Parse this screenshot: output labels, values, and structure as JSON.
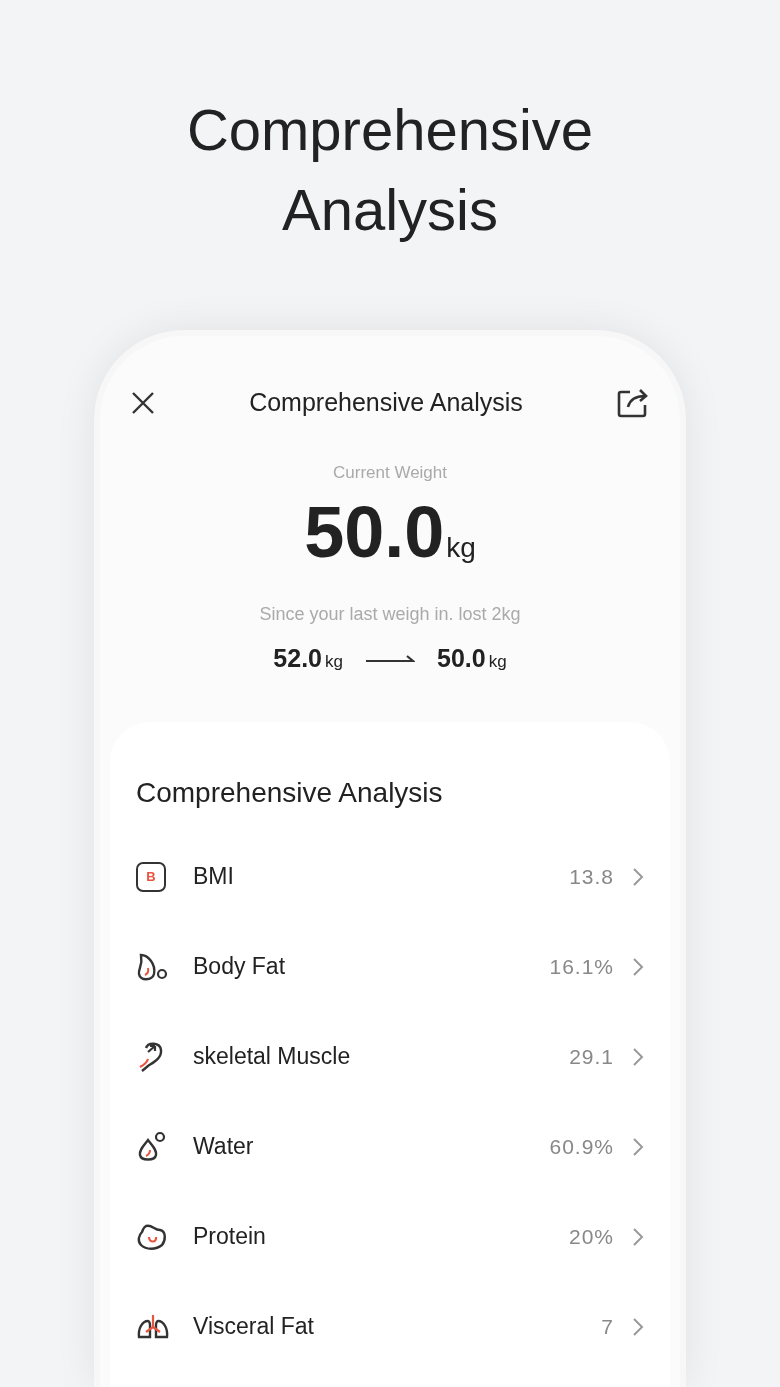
{
  "headline": [
    "Comprehensive",
    "Analysis"
  ],
  "header": {
    "title": "Comprehensive Analysis"
  },
  "current": {
    "label": "Current Weight",
    "value": "50.0",
    "unit": "kg"
  },
  "change": {
    "text": "Since your last weigh in. lost 2kg",
    "from_value": "52.0",
    "from_unit": "kg",
    "to_value": "50.0",
    "to_unit": "kg"
  },
  "analysis": {
    "title": "Comprehensive Analysis",
    "items": [
      {
        "kind": "bmi",
        "icon_letter": "B",
        "label": "BMI",
        "value": "13.8"
      },
      {
        "kind": "fat",
        "label": "Body Fat",
        "value": "16.1%"
      },
      {
        "kind": "muscle",
        "label": "skeletal Muscle",
        "value": "29.1"
      },
      {
        "kind": "water",
        "label": "Water",
        "value": "60.9%"
      },
      {
        "kind": "protein",
        "label": "Protein",
        "value": "20%"
      },
      {
        "kind": "visceral",
        "label": "Visceral Fat",
        "value": "7"
      }
    ]
  }
}
